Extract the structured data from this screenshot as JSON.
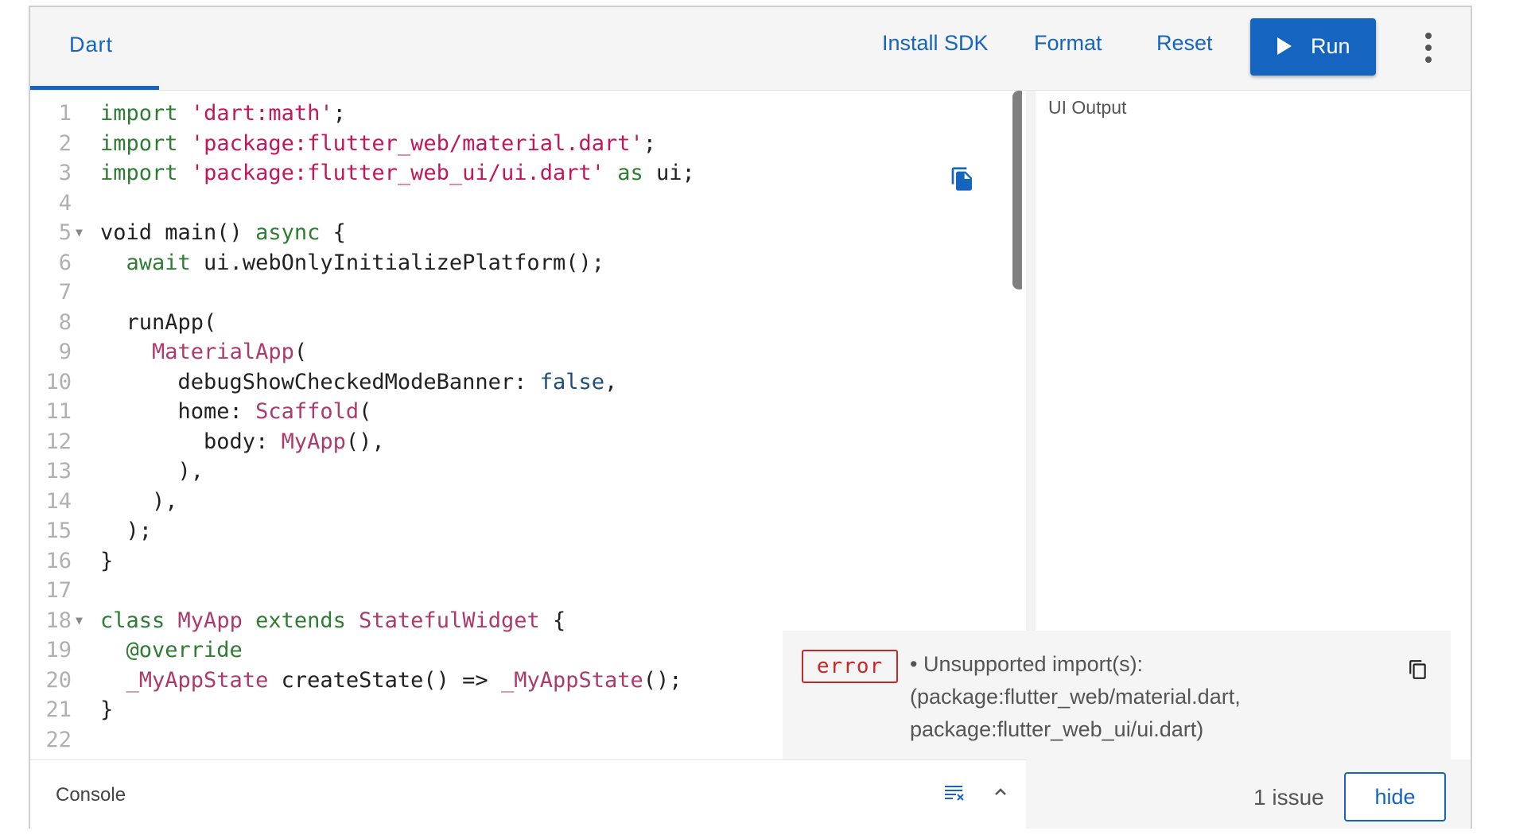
{
  "header": {
    "tab_label": "Dart",
    "install_sdk_label": "Install SDK",
    "format_label": "Format",
    "reset_label": "Reset",
    "run_label": "Run",
    "accent_color": "#1565c0"
  },
  "editor": {
    "lines": [
      {
        "n": "1",
        "segs": [
          [
            "kw",
            "import"
          ],
          [
            "p",
            " "
          ],
          [
            "str",
            "'dart:math'"
          ],
          [
            "p",
            ";"
          ]
        ]
      },
      {
        "n": "2",
        "segs": [
          [
            "kw",
            "import"
          ],
          [
            "p",
            " "
          ],
          [
            "str",
            "'package:flutter_web/material.dart'"
          ],
          [
            "p",
            ";"
          ]
        ]
      },
      {
        "n": "3",
        "segs": [
          [
            "kw",
            "import"
          ],
          [
            "p",
            " "
          ],
          [
            "str",
            "'package:flutter_web_ui/ui.dart'"
          ],
          [
            "p",
            " "
          ],
          [
            "kw",
            "as"
          ],
          [
            "p",
            " ui;"
          ]
        ]
      },
      {
        "n": "4",
        "segs": []
      },
      {
        "n": "5",
        "fold": true,
        "segs": [
          [
            "p",
            "void main() "
          ],
          [
            "kw",
            "async"
          ],
          [
            "p",
            " {"
          ]
        ]
      },
      {
        "n": "6",
        "segs": [
          [
            "p",
            "  "
          ],
          [
            "kw",
            "await"
          ],
          [
            "p",
            " ui.webOnlyInitializePlatform();"
          ]
        ]
      },
      {
        "n": "7",
        "segs": []
      },
      {
        "n": "8",
        "segs": [
          [
            "p",
            "  runApp("
          ]
        ]
      },
      {
        "n": "9",
        "segs": [
          [
            "p",
            "    "
          ],
          [
            "cls",
            "MaterialApp"
          ],
          [
            "p",
            "("
          ]
        ]
      },
      {
        "n": "10",
        "segs": [
          [
            "p",
            "      debugShowCheckedModeBanner: "
          ],
          [
            "kwb",
            "false"
          ],
          [
            "p",
            ","
          ]
        ]
      },
      {
        "n": "11",
        "segs": [
          [
            "p",
            "      home: "
          ],
          [
            "cls",
            "Scaffold"
          ],
          [
            "p",
            "("
          ]
        ]
      },
      {
        "n": "12",
        "segs": [
          [
            "p",
            "        body: "
          ],
          [
            "cls",
            "MyApp"
          ],
          [
            "p",
            "(),"
          ]
        ]
      },
      {
        "n": "13",
        "segs": [
          [
            "p",
            "      ),"
          ]
        ]
      },
      {
        "n": "14",
        "segs": [
          [
            "p",
            "    ),"
          ]
        ]
      },
      {
        "n": "15",
        "segs": [
          [
            "p",
            "  );"
          ]
        ]
      },
      {
        "n": "16",
        "segs": [
          [
            "p",
            "}"
          ]
        ]
      },
      {
        "n": "17",
        "segs": []
      },
      {
        "n": "18",
        "fold": true,
        "segs": [
          [
            "kw",
            "class"
          ],
          [
            "p",
            " "
          ],
          [
            "cls",
            "MyApp"
          ],
          [
            "p",
            " "
          ],
          [
            "kw",
            "extends"
          ],
          [
            "p",
            " "
          ],
          [
            "cls",
            "StatefulWidget"
          ],
          [
            "p",
            " {"
          ]
        ]
      },
      {
        "n": "19",
        "segs": [
          [
            "p",
            "  "
          ],
          [
            "kw",
            "@override"
          ]
        ]
      },
      {
        "n": "20",
        "segs": [
          [
            "p",
            "  "
          ],
          [
            "cls",
            "_MyAppState"
          ],
          [
            "p",
            " createState() => "
          ],
          [
            "cls",
            "_MyAppState"
          ],
          [
            "p",
            "();"
          ]
        ]
      },
      {
        "n": "21",
        "segs": [
          [
            "p",
            "}"
          ]
        ]
      },
      {
        "n": "22",
        "segs": []
      }
    ]
  },
  "output": {
    "title": "UI Output"
  },
  "issues": {
    "badge": "error",
    "message": "• Unsupported import(s): (package:flutter_web/material.dart, package:flutter_web_ui/ui.dart)",
    "count_label": "1 issue",
    "hide_label": "hide"
  },
  "console": {
    "label": "Console"
  }
}
